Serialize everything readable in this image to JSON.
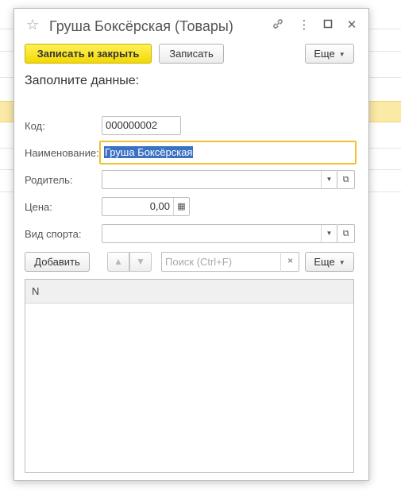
{
  "window": {
    "title": "Груша Боксёрская (Товары)",
    "star_icon": "☆",
    "link_icon": "🔗",
    "more_icon": "⋮",
    "maximize_icon": "☐",
    "close_icon": "✕"
  },
  "toolbar": {
    "save_close_label": "Записать и закрыть",
    "save_label": "Записать",
    "more_label": "Еще"
  },
  "form": {
    "section_title": "Заполните данные:",
    "code_label": "Код:",
    "code_value": "000000002",
    "name_label": "Наименование:",
    "name_value": "Груша Боксёрская",
    "parent_label": "Родитель:",
    "parent_value": "",
    "price_label": "Цена:",
    "price_value": "0,00",
    "sport_label": "Вид спорта:",
    "sport_value": ""
  },
  "table_toolbar": {
    "add_label": "Добавить",
    "up_icon": "▲",
    "down_icon": "▼",
    "search_placeholder": "Поиск (Ctrl+F)",
    "clear_icon": "×",
    "more_label": "Еще"
  },
  "table": {
    "columns": [
      "N"
    ],
    "rows": []
  },
  "colors": {
    "primary_button": "#f5dc0e",
    "focus_border": "#f0c030",
    "selection": "#3b72c4",
    "selected_row": "#fbe9a6"
  }
}
